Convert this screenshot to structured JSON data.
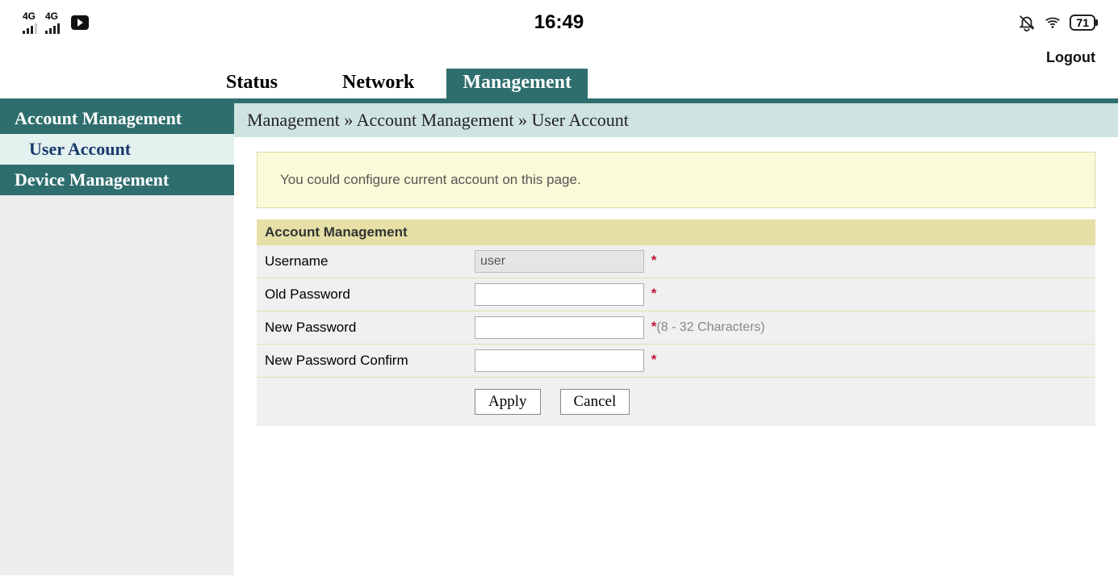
{
  "statusbar": {
    "signal_label": "4G",
    "time": "16:49",
    "battery": "71"
  },
  "header": {
    "logout": "Logout"
  },
  "top_tabs": {
    "status": "Status",
    "network": "Network",
    "management": "Management"
  },
  "sidebar": {
    "account_mgmt": "Account Management",
    "user_account": "User Account",
    "device_mgmt": "Device Management"
  },
  "breadcrumb": "Management » Account Management » User Account",
  "info_text": "You could configure current account on this page.",
  "panel": {
    "title": "Account Management",
    "username_label": "Username",
    "username_value": "user",
    "old_pw_label": "Old Password",
    "new_pw_label": "New Password",
    "new_pw_hint": "(8 - 32 Characters)",
    "new_pw_confirm_label": "New Password Confirm",
    "required_mark": "*",
    "apply": "Apply",
    "cancel": "Cancel"
  }
}
